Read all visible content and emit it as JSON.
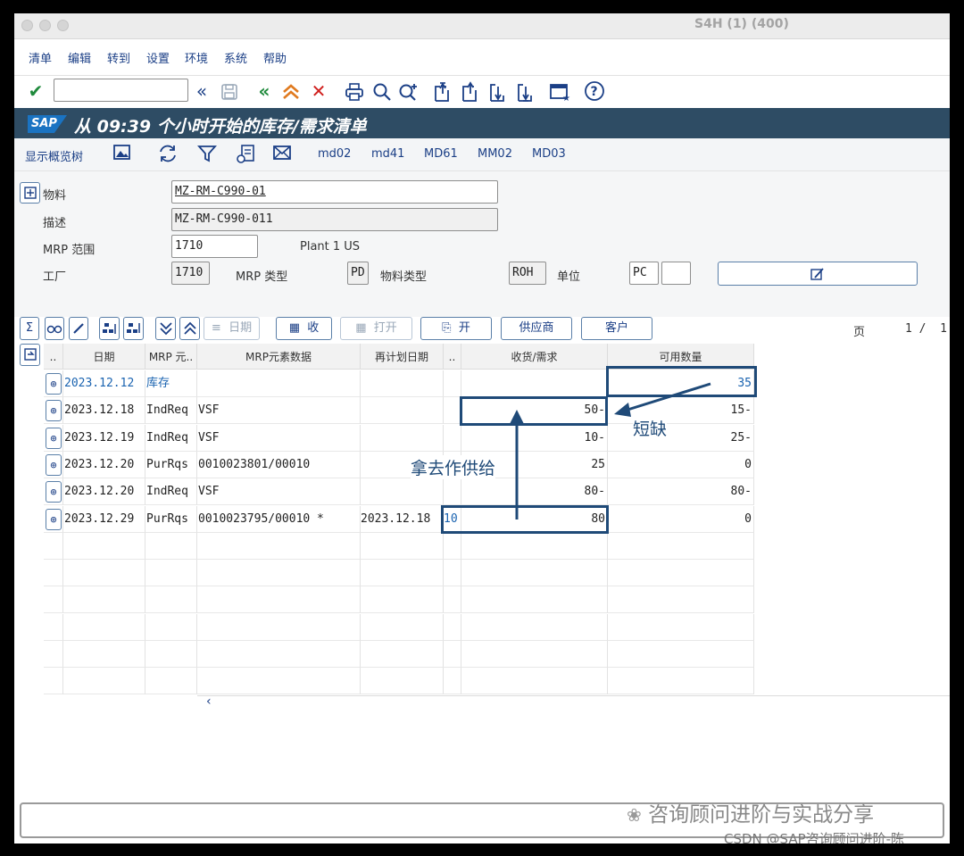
{
  "window": {
    "title": "S4H (1) (400)"
  },
  "menu": [
    "清单",
    "编辑",
    "转到",
    "设置",
    "环境",
    "系统",
    "帮助"
  ],
  "header": {
    "logo": "SAP",
    "title": "从 09:39 个小时开始的库存/需求清单"
  },
  "app_toolbar": {
    "tree_label": "显示概览树",
    "links": [
      "md02",
      "md41",
      "MD61",
      "MM02",
      "MD03"
    ]
  },
  "form": {
    "material_label": "物料",
    "material_value": "MZ-RM-C990-01",
    "desc_label": "描述",
    "desc_value": "MZ-RM-C990-011",
    "mrp_area_label": "MRP 范围",
    "mrp_area_value": "1710",
    "mrp_area_text": "Plant 1 US",
    "plant_label": "工厂",
    "plant_value": "1710",
    "mrp_type_label": "MRP 类型",
    "mrp_type_value": "PD",
    "mat_type_label": "物料类型",
    "mat_type_value": "ROH",
    "unit_label": "单位",
    "unit_value": "PC"
  },
  "grid_toolbar": {
    "date_btn": "日期",
    "receipt_btn": "收",
    "open_btn": "打开",
    "open2_btn": "开",
    "vendor_btn": "供应商",
    "customer_btn": "客户",
    "page_label": "页",
    "page_value": "1 /  1"
  },
  "grid": {
    "headers": {
      "dots1": "..",
      "date": "日期",
      "mrp_elem": "MRP 元..",
      "elem_data": "MRP元素数据",
      "resched": "再计划日期",
      "dots2": "..",
      "receipt": "收货/需求",
      "avail": "可用数量"
    },
    "rows": [
      {
        "date": "2023.12.12",
        "elem": "库存",
        "data": "",
        "resched": "",
        "ex": "",
        "qty": "",
        "avail": "35"
      },
      {
        "date": "2023.12.18",
        "elem": "IndReq",
        "data": "VSF",
        "resched": "",
        "ex": "",
        "qty": "50-",
        "avail": "15-"
      },
      {
        "date": "2023.12.19",
        "elem": "IndReq",
        "data": "VSF",
        "resched": "",
        "ex": "",
        "qty": "10-",
        "avail": "25-"
      },
      {
        "date": "2023.12.20",
        "elem": "PurRqs",
        "data": "0010023801/00010",
        "resched": "",
        "ex": "",
        "qty": "25",
        "avail": "0"
      },
      {
        "date": "2023.12.20",
        "elem": "IndReq",
        "data": "VSF",
        "resched": "",
        "ex": "",
        "qty": "80-",
        "avail": "80-"
      },
      {
        "date": "2023.12.29",
        "elem": "PurRqs",
        "data": "0010023795/00010 *",
        "resched": "2023.12.18",
        "ex": "10",
        "qty": "80",
        "avail": "0"
      }
    ],
    "scroll_left": "‹"
  },
  "annotations": {
    "shortage": "短缺",
    "supply": "拿去作供给"
  },
  "watermark": {
    "line1": "咨询顾问进阶与实战分享",
    "line2": "CSDN @SAP咨询顾问进阶-陈"
  },
  "colors": {
    "header_bg": "#2e4c64",
    "link": "#1b3f86",
    "annotation": "#1f4a78",
    "check": "#1f8a3c",
    "orange": "#e07a1f",
    "red": "#d0201e"
  }
}
